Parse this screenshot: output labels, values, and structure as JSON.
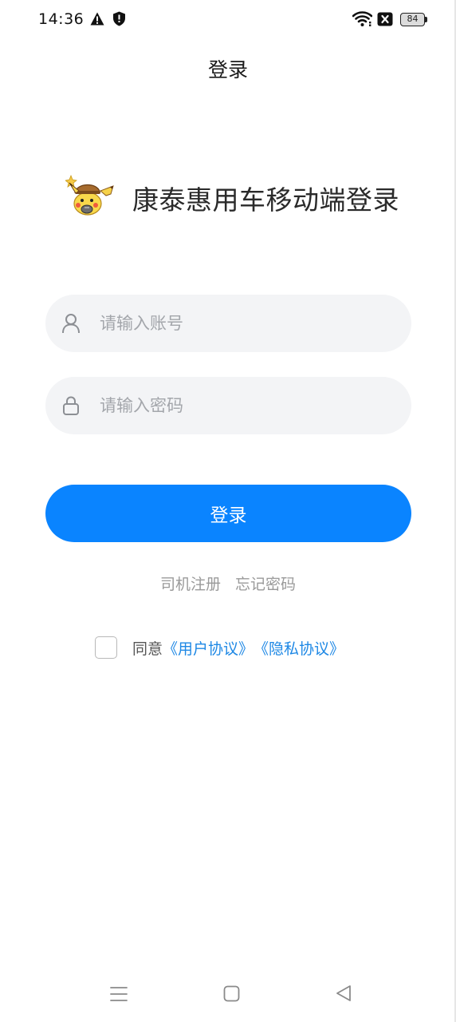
{
  "status_bar": {
    "time": "14:36",
    "battery": "84",
    "icons": [
      "warning-icon",
      "shield-icon",
      "wifi-icon",
      "sim-off-icon",
      "battery-icon"
    ]
  },
  "header": {
    "title": "登录"
  },
  "app": {
    "heading": "康泰惠用车移动端登录",
    "logo_icon": "pikachu-detective-logo"
  },
  "form": {
    "account_placeholder": "请输入账号",
    "account_value": "",
    "account_icon": "user-icon",
    "password_placeholder": "请输入密码",
    "password_value": "",
    "password_icon": "lock-icon",
    "login_label": "登录"
  },
  "links": {
    "register": "司机注册",
    "forgot": "忘记密码"
  },
  "agreement": {
    "prefix": "同意",
    "user_agreement": "《用户协议》",
    "privacy_policy": "《隐私协议》",
    "checked": false
  },
  "colors": {
    "primary": "#0a84ff",
    "link": "#1e88e5",
    "input_bg": "#f3f4f6"
  },
  "nav_bar": {
    "icons": [
      "menu-icon",
      "home-icon",
      "back-icon"
    ]
  }
}
